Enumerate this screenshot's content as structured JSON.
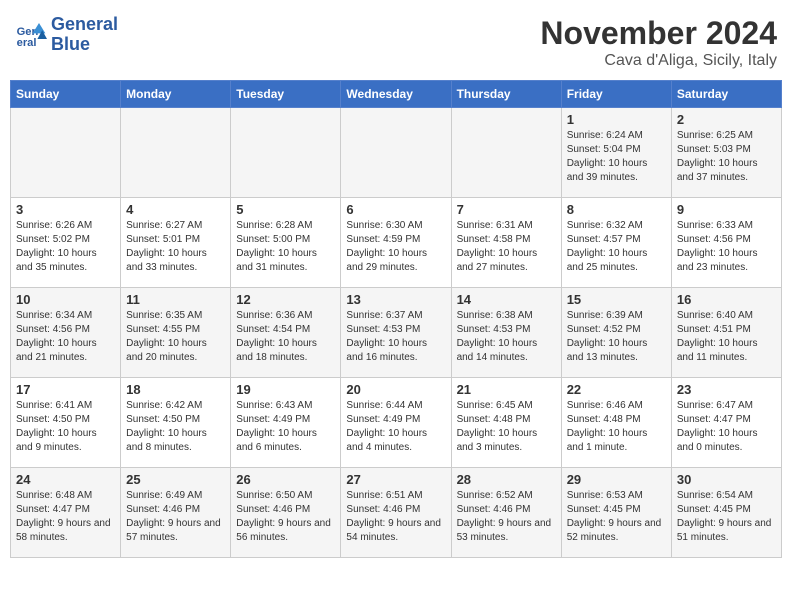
{
  "logo": {
    "line1": "General",
    "line2": "Blue"
  },
  "title": "November 2024",
  "location": "Cava d'Aliga, Sicily, Italy",
  "weekdays": [
    "Sunday",
    "Monday",
    "Tuesday",
    "Wednesday",
    "Thursday",
    "Friday",
    "Saturday"
  ],
  "weeks": [
    [
      {
        "day": "",
        "info": ""
      },
      {
        "day": "",
        "info": ""
      },
      {
        "day": "",
        "info": ""
      },
      {
        "day": "",
        "info": ""
      },
      {
        "day": "",
        "info": ""
      },
      {
        "day": "1",
        "info": "Sunrise: 6:24 AM\nSunset: 5:04 PM\nDaylight: 10 hours and 39 minutes."
      },
      {
        "day": "2",
        "info": "Sunrise: 6:25 AM\nSunset: 5:03 PM\nDaylight: 10 hours and 37 minutes."
      }
    ],
    [
      {
        "day": "3",
        "info": "Sunrise: 6:26 AM\nSunset: 5:02 PM\nDaylight: 10 hours and 35 minutes."
      },
      {
        "day": "4",
        "info": "Sunrise: 6:27 AM\nSunset: 5:01 PM\nDaylight: 10 hours and 33 minutes."
      },
      {
        "day": "5",
        "info": "Sunrise: 6:28 AM\nSunset: 5:00 PM\nDaylight: 10 hours and 31 minutes."
      },
      {
        "day": "6",
        "info": "Sunrise: 6:30 AM\nSunset: 4:59 PM\nDaylight: 10 hours and 29 minutes."
      },
      {
        "day": "7",
        "info": "Sunrise: 6:31 AM\nSunset: 4:58 PM\nDaylight: 10 hours and 27 minutes."
      },
      {
        "day": "8",
        "info": "Sunrise: 6:32 AM\nSunset: 4:57 PM\nDaylight: 10 hours and 25 minutes."
      },
      {
        "day": "9",
        "info": "Sunrise: 6:33 AM\nSunset: 4:56 PM\nDaylight: 10 hours and 23 minutes."
      }
    ],
    [
      {
        "day": "10",
        "info": "Sunrise: 6:34 AM\nSunset: 4:56 PM\nDaylight: 10 hours and 21 minutes."
      },
      {
        "day": "11",
        "info": "Sunrise: 6:35 AM\nSunset: 4:55 PM\nDaylight: 10 hours and 20 minutes."
      },
      {
        "day": "12",
        "info": "Sunrise: 6:36 AM\nSunset: 4:54 PM\nDaylight: 10 hours and 18 minutes."
      },
      {
        "day": "13",
        "info": "Sunrise: 6:37 AM\nSunset: 4:53 PM\nDaylight: 10 hours and 16 minutes."
      },
      {
        "day": "14",
        "info": "Sunrise: 6:38 AM\nSunset: 4:53 PM\nDaylight: 10 hours and 14 minutes."
      },
      {
        "day": "15",
        "info": "Sunrise: 6:39 AM\nSunset: 4:52 PM\nDaylight: 10 hours and 13 minutes."
      },
      {
        "day": "16",
        "info": "Sunrise: 6:40 AM\nSunset: 4:51 PM\nDaylight: 10 hours and 11 minutes."
      }
    ],
    [
      {
        "day": "17",
        "info": "Sunrise: 6:41 AM\nSunset: 4:50 PM\nDaylight: 10 hours and 9 minutes."
      },
      {
        "day": "18",
        "info": "Sunrise: 6:42 AM\nSunset: 4:50 PM\nDaylight: 10 hours and 8 minutes."
      },
      {
        "day": "19",
        "info": "Sunrise: 6:43 AM\nSunset: 4:49 PM\nDaylight: 10 hours and 6 minutes."
      },
      {
        "day": "20",
        "info": "Sunrise: 6:44 AM\nSunset: 4:49 PM\nDaylight: 10 hours and 4 minutes."
      },
      {
        "day": "21",
        "info": "Sunrise: 6:45 AM\nSunset: 4:48 PM\nDaylight: 10 hours and 3 minutes."
      },
      {
        "day": "22",
        "info": "Sunrise: 6:46 AM\nSunset: 4:48 PM\nDaylight: 10 hours and 1 minute."
      },
      {
        "day": "23",
        "info": "Sunrise: 6:47 AM\nSunset: 4:47 PM\nDaylight: 10 hours and 0 minutes."
      }
    ],
    [
      {
        "day": "24",
        "info": "Sunrise: 6:48 AM\nSunset: 4:47 PM\nDaylight: 9 hours and 58 minutes."
      },
      {
        "day": "25",
        "info": "Sunrise: 6:49 AM\nSunset: 4:46 PM\nDaylight: 9 hours and 57 minutes."
      },
      {
        "day": "26",
        "info": "Sunrise: 6:50 AM\nSunset: 4:46 PM\nDaylight: 9 hours and 56 minutes."
      },
      {
        "day": "27",
        "info": "Sunrise: 6:51 AM\nSunset: 4:46 PM\nDaylight: 9 hours and 54 minutes."
      },
      {
        "day": "28",
        "info": "Sunrise: 6:52 AM\nSunset: 4:46 PM\nDaylight: 9 hours and 53 minutes."
      },
      {
        "day": "29",
        "info": "Sunrise: 6:53 AM\nSunset: 4:45 PM\nDaylight: 9 hours and 52 minutes."
      },
      {
        "day": "30",
        "info": "Sunrise: 6:54 AM\nSunset: 4:45 PM\nDaylight: 9 hours and 51 minutes."
      }
    ]
  ]
}
